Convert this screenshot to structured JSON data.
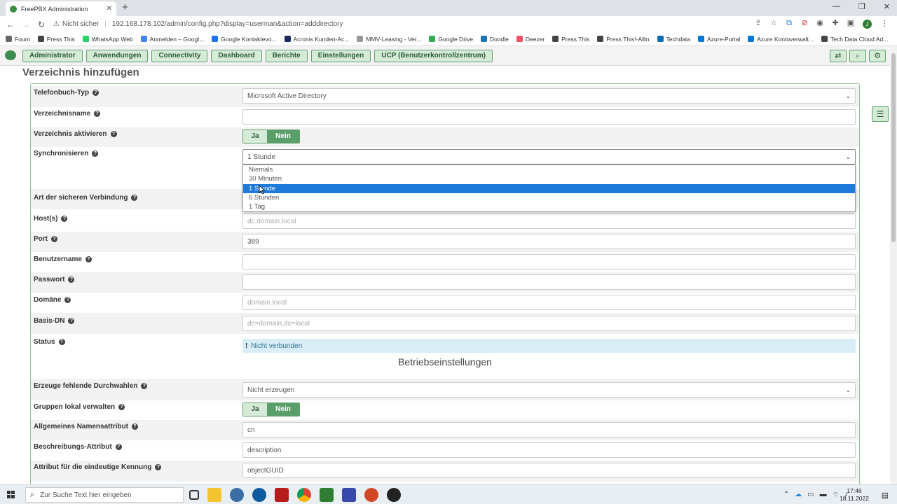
{
  "browser": {
    "tab_title": "FreePBX Administration",
    "new_tab": "+",
    "omnibox_insecure": "Nicht sicher",
    "url": "192.168.178.102/admin/config.php?display=userman&action=adddirectory",
    "profile_initial": "J",
    "bookmarks": [
      {
        "label": "Fount",
        "color": "#666"
      },
      {
        "label": "Press This",
        "color": "#444"
      },
      {
        "label": "WhatsApp Web",
        "color": "#25d366"
      },
      {
        "label": "Anmelden – Googl...",
        "color": "#4285f4"
      },
      {
        "label": "Google Kontaktevo...",
        "color": "#1a73e8"
      },
      {
        "label": "Acronis Kunden-Ac...",
        "color": "#1b2a5c"
      },
      {
        "label": "MMV-Leasing - Ver...",
        "color": "#999"
      },
      {
        "label": "Google Drive",
        "color": "#34a853"
      },
      {
        "label": "Doodle",
        "color": "#1f73b7"
      },
      {
        "label": "Deezer",
        "color": "#ef5466"
      },
      {
        "label": "Press This",
        "color": "#444"
      },
      {
        "label": "Press This!-Allin",
        "color": "#444"
      },
      {
        "label": "Techdata",
        "color": "#0b6bb5"
      },
      {
        "label": "Azure-Portal",
        "color": "#0078d4"
      },
      {
        "label": "Azure Kontoverwalt...",
        "color": "#0078d4"
      },
      {
        "label": "Tech Data Cloud Ad...",
        "color": "#444"
      }
    ]
  },
  "nav": {
    "items": [
      "Administrator",
      "Anwendungen",
      "Connectivity",
      "Dashboard",
      "Berichte",
      "Einstellungen",
      "UCP (Benutzerkontrollzentrum)"
    ]
  },
  "page": {
    "title": "Verzeichnis hinzufügen",
    "fields": {
      "phonebook_type": {
        "label": "Telefonbuch-Typ",
        "value": "Microsoft Active Directory"
      },
      "directory_name": {
        "label": "Verzeichnisname",
        "value": ""
      },
      "directory_enable": {
        "label": "Verzeichnis aktivieren",
        "yes": "Ja",
        "no": "Nein"
      },
      "sync": {
        "label": "Synchronisieren",
        "value": "1 Stunde"
      },
      "secure_conn": {
        "label": "Art der sicheren Verbindung"
      },
      "hosts": {
        "label": "Host(s)",
        "placeholder": "dc.domain.local"
      },
      "port": {
        "label": "Port",
        "value": "389"
      },
      "username": {
        "label": "Benutzername",
        "value": ""
      },
      "password": {
        "label": "Passwort",
        "value": ""
      },
      "domain": {
        "label": "Domäne",
        "placeholder": "domain.local"
      },
      "base_dn": {
        "label": "Basis-DN",
        "placeholder": "dc=domain,dc=local"
      },
      "status": {
        "label": "Status",
        "icon": "!",
        "value": "Nicht verbunden"
      }
    },
    "sync_options": [
      "Niemals",
      "30 Minuten",
      "1 Stunde",
      "6 Stunden",
      "1 Tag"
    ],
    "sync_selected_index": 2,
    "section_operation": "Betriebseinstellungen",
    "op_fields": {
      "create_missing": {
        "label": "Erzeuge fehlende Durchwahlen",
        "value": "Nicht erzeugen"
      },
      "groups_local": {
        "label": "Gruppen lokal verwalten",
        "yes": "Ja",
        "no": "Nein"
      },
      "name_attr": {
        "label": "Allgemeines Namensattribut",
        "value": "cn"
      },
      "desc_attr": {
        "label": "Beschreibungs-Attribut",
        "value": "description"
      },
      "uid_attr": {
        "label": "Attribut für die eindeutige Kennung",
        "value": "objectGUID"
      }
    }
  },
  "taskbar": {
    "search_placeholder": "Zur Suche Text hier eingeben",
    "time": "17:46",
    "date": "18.11.2022"
  }
}
